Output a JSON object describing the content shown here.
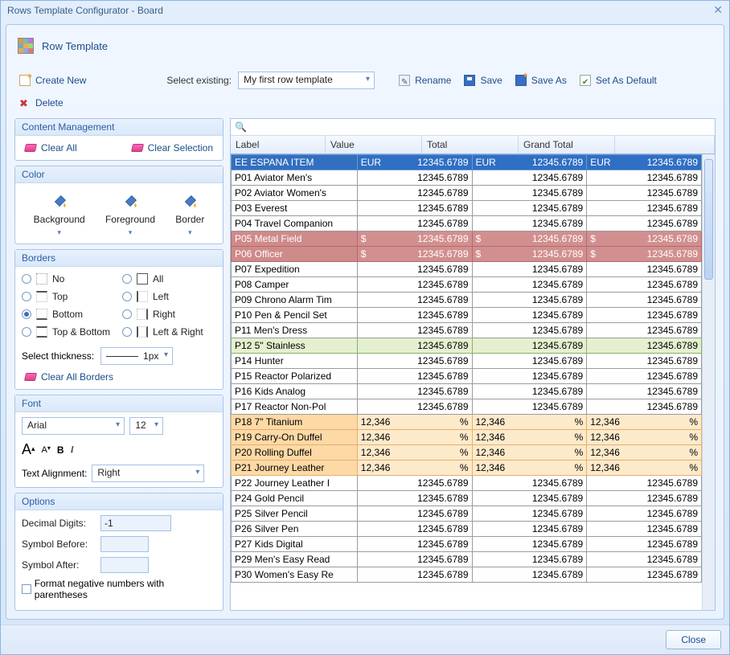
{
  "window": {
    "title": "Rows Template Configurator - Board",
    "header": "Row Template"
  },
  "toolbar": {
    "create_new": "Create New",
    "select_existing_label": "Select existing:",
    "template_name": "My first row template",
    "rename": "Rename",
    "save": "Save",
    "save_as": "Save As",
    "set_default": "Set As Default",
    "delete": "Delete"
  },
  "panels": {
    "content_mgmt": {
      "title": "Content Management",
      "clear_all": "Clear All",
      "clear_selection": "Clear Selection"
    },
    "color": {
      "title": "Color",
      "background": "Background",
      "foreground": "Foreground",
      "border": "Border"
    },
    "borders": {
      "title": "Borders",
      "opts": {
        "no": "No",
        "all": "All",
        "top": "Top",
        "left": "Left",
        "bottom": "Bottom",
        "right": "Right",
        "tb": "Top & Bottom",
        "lr": "Left & Right"
      },
      "selected": "bottom",
      "thickness_label": "Select thickness:",
      "thickness_value": "1px",
      "clear_all_borders": "Clear All Borders"
    },
    "font": {
      "title": "Font",
      "family": "Arial",
      "size": "12",
      "alignment_label": "Text Alignment:",
      "alignment_value": "Right"
    },
    "options": {
      "title": "Options",
      "decimal_label": "Decimal Digits:",
      "decimal_value": "-1",
      "before_label": "Symbol Before:",
      "before_value": "",
      "after_label": "Symbol After:",
      "after_value": "",
      "neg_paren": "Format negative numbers with parentheses"
    }
  },
  "grid": {
    "columns": {
      "label": "Label",
      "value": "Value",
      "total": "Total",
      "grand_total": "Grand Total"
    },
    "rows": [
      {
        "style": "blue",
        "label": "EE ESPANA ITEM",
        "sym": "EUR",
        "v": "12345.6789",
        "t": "12345.6789",
        "g": "12345.6789"
      },
      {
        "style": "plain",
        "label": "P01 Aviator Men's",
        "sym": "",
        "v": "12345.6789",
        "t": "12345.6789",
        "g": "12345.6789"
      },
      {
        "style": "plain",
        "label": "P02 Aviator Women's",
        "sym": "",
        "v": "12345.6789",
        "t": "12345.6789",
        "g": "12345.6789"
      },
      {
        "style": "plain",
        "label": "P03 Everest",
        "sym": "",
        "v": "12345.6789",
        "t": "12345.6789",
        "g": "12345.6789"
      },
      {
        "style": "plain",
        "label": "P04 Travel Companion",
        "sym": "",
        "v": "12345.6789",
        "t": "12345.6789",
        "g": "12345.6789"
      },
      {
        "style": "red",
        "label": "P05 Metal Field",
        "sym": "$",
        "v": "12345.6789",
        "t": "12345.6789",
        "g": "12345.6789"
      },
      {
        "style": "red",
        "label": "P06 Officer",
        "sym": "$",
        "v": "12345.6789",
        "t": "12345.6789",
        "g": "12345.6789"
      },
      {
        "style": "plain",
        "label": "P07 Expedition",
        "sym": "",
        "v": "12345.6789",
        "t": "12345.6789",
        "g": "12345.6789"
      },
      {
        "style": "plain",
        "label": "P08 Camper",
        "sym": "",
        "v": "12345.6789",
        "t": "12345.6789",
        "g": "12345.6789"
      },
      {
        "style": "plain",
        "label": "P09 Chrono Alarm Tim",
        "sym": "",
        "v": "12345.6789",
        "t": "12345.6789",
        "g": "12345.6789"
      },
      {
        "style": "plain",
        "label": "P10 Pen & Pencil Set",
        "sym": "",
        "v": "12345.6789",
        "t": "12345.6789",
        "g": "12345.6789"
      },
      {
        "style": "plain",
        "label": "P11 Men's Dress",
        "sym": "",
        "v": "12345.6789",
        "t": "12345.6789",
        "g": "12345.6789"
      },
      {
        "style": "green",
        "label": "P12 5\" Stainless",
        "sym": "",
        "v": "12345.6789",
        "t": "12345.6789",
        "g": "12345.6789"
      },
      {
        "style": "plain",
        "label": "P14 Hunter",
        "sym": "",
        "v": "12345.6789",
        "t": "12345.6789",
        "g": "12345.6789"
      },
      {
        "style": "plain",
        "label": "P15 Reactor Polarized",
        "sym": "",
        "v": "12345.6789",
        "t": "12345.6789",
        "g": "12345.6789"
      },
      {
        "style": "plain",
        "label": "P16 Kids Analog",
        "sym": "",
        "v": "12345.6789",
        "t": "12345.6789",
        "g": "12345.6789"
      },
      {
        "style": "plain",
        "label": "P17 Reactor Non-Pol",
        "sym": "",
        "v": "12345.6789",
        "t": "12345.6789",
        "g": "12345.6789"
      },
      {
        "style": "orange",
        "label": "P18 7\" Titanium",
        "sym": "",
        "v": "12,346",
        "t": "12,346",
        "g": "12,346",
        "suffix": "%"
      },
      {
        "style": "orange",
        "label": "P19 Carry-On Duffel",
        "sym": "",
        "v": "12,346",
        "t": "12,346",
        "g": "12,346",
        "suffix": "%"
      },
      {
        "style": "orange",
        "label": "P20 Rolling Duffel",
        "sym": "",
        "v": "12,346",
        "t": "12,346",
        "g": "12,346",
        "suffix": "%"
      },
      {
        "style": "orange",
        "label": "P21 Journey Leather",
        "sym": "",
        "v": "12,346",
        "t": "12,346",
        "g": "12,346",
        "suffix": "%"
      },
      {
        "style": "plain",
        "label": "P22 Journey Leather I",
        "sym": "",
        "v": "12345.6789",
        "t": "12345.6789",
        "g": "12345.6789"
      },
      {
        "style": "plain",
        "label": "P24 Gold Pencil",
        "sym": "",
        "v": "12345.6789",
        "t": "12345.6789",
        "g": "12345.6789"
      },
      {
        "style": "plain",
        "label": "P25 Silver Pencil",
        "sym": "",
        "v": "12345.6789",
        "t": "12345.6789",
        "g": "12345.6789"
      },
      {
        "style": "plain",
        "label": "P26 Silver Pen",
        "sym": "",
        "v": "12345.6789",
        "t": "12345.6789",
        "g": "12345.6789"
      },
      {
        "style": "plain",
        "label": "P27 Kids Digital",
        "sym": "",
        "v": "12345.6789",
        "t": "12345.6789",
        "g": "12345.6789"
      },
      {
        "style": "plain",
        "label": "P29 Men's Easy Read",
        "sym": "",
        "v": "12345.6789",
        "t": "12345.6789",
        "g": "12345.6789"
      },
      {
        "style": "plain",
        "label": "P30 Women's Easy Re",
        "sym": "",
        "v": "12345.6789",
        "t": "12345.6789",
        "g": "12345.6789"
      }
    ]
  },
  "footer": {
    "close": "Close"
  }
}
